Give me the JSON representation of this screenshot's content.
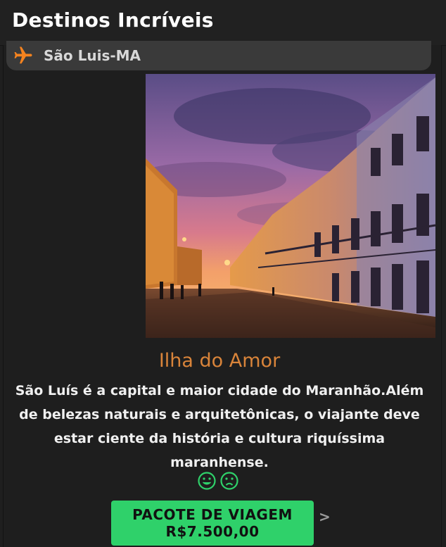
{
  "app": {
    "title": "Destinos Incríveis"
  },
  "location": {
    "name": "São Luis-MA",
    "icon": "airplane-icon",
    "accent": "#f5831f"
  },
  "destination": {
    "photo_alt": "colonial-street-sunset-photo",
    "title": "Ilha do Amor",
    "title_color": "#d9843a",
    "description": "São Luís é a capital e maior cidade do Maranhão.Além de belezas naturais e arquitetônicas, o viajante deve estar ciente da história e cultura riquíssima maranhense."
  },
  "reactions": {
    "like_icon": "smile-icon",
    "dislike_icon": "frown-icon",
    "color": "#2fd16a"
  },
  "package_button": {
    "line1": "PACOTE DE VIAGEM",
    "line2": "R$7.500,00",
    "color": "#2fd16a"
  },
  "nav": {
    "next": ">"
  }
}
